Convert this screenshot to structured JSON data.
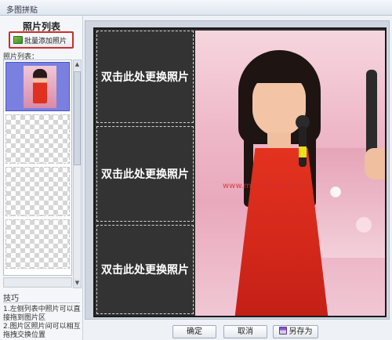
{
  "window": {
    "title": "多图拼贴"
  },
  "sidebar": {
    "title": "照片列表",
    "add_button_label": "批量添加照片",
    "list_label": "照片列表：",
    "tips_title": "技巧",
    "tips": [
      "1.左侧列表中照片可以直接拖到图片区",
      "2.图片区照片间可以相互拖拽交换位置"
    ]
  },
  "canvas": {
    "slots": [
      {
        "label": "双击此处更换照片"
      },
      {
        "label": "双击此处更换照片"
      },
      {
        "label": "双击此处更换照片"
      }
    ],
    "watermark": "www.mininchang.com"
  },
  "footer": {
    "ok_label": "确定",
    "cancel_label": "取消",
    "saveas_label": "另存为"
  }
}
